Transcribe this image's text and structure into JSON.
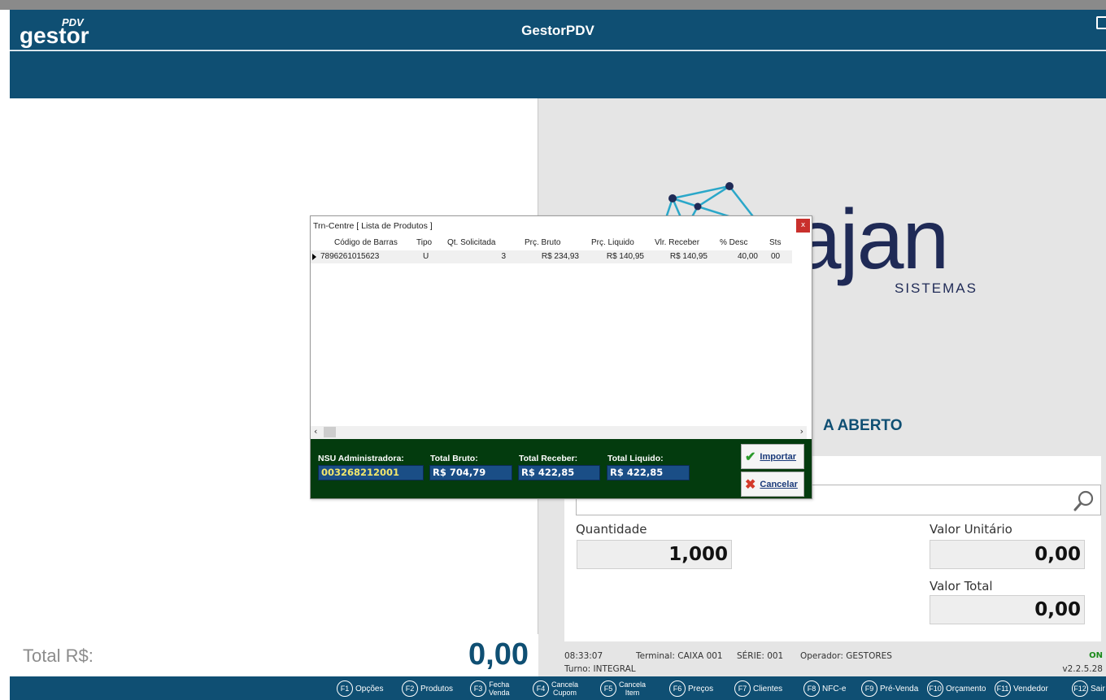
{
  "app": {
    "logo_main": "gestor",
    "logo_sup": "PDV",
    "title": "GestorPDV"
  },
  "brand": {
    "name": "rajan",
    "sub": "SISTEMAS"
  },
  "status": "A ABERTO",
  "fields": {
    "quantidade_label": "Quantidade",
    "quantidade_value": "1,000",
    "valor_unitario_label": "Valor Unitário",
    "valor_unitario_value": "0,00",
    "valor_total_label": "Valor Total",
    "valor_total_value": "0,00"
  },
  "total": {
    "label": "Total R$:",
    "value": "0,00"
  },
  "info": {
    "time": "08:33:07",
    "terminal": "Terminal: CAIXA 001",
    "serie": "SÉRIE: 001",
    "operador": "Operador: GESTORES",
    "turno": "Turno: INTEGRAL",
    "connection": "ON",
    "version": "v2.2.5.28"
  },
  "dialog": {
    "title": "Trn-Centre [ Lista de Produtos ]",
    "close": "x",
    "columns": [
      "Código de Barras",
      "Tipo",
      "Qt. Solicitada",
      "Prç. Bruto",
      "Prç. Liquido",
      "Vlr. Receber",
      "% Desc",
      "Sts"
    ],
    "row": {
      "codigo": "7896261015623",
      "tipo": "U",
      "qt": "3",
      "bruto": "R$ 234,93",
      "liquido": "R$ 140,95",
      "receber": "R$ 140,95",
      "desc": "40,00",
      "sts": "00"
    },
    "nsu_label": "NSU Administradora:",
    "nsu_value": "003268212001",
    "total_bruto_label": "Total Bruto:",
    "total_bruto_value": "R$ 704,79",
    "total_receber_label": "Total Receber:",
    "total_receber_value": "R$ 422,85",
    "total_liquido_label": "Total Liquido:",
    "total_liquido_value": "R$ 422,85",
    "importar_label": "Importar",
    "cancelar_label": "Cancelar"
  },
  "fkeys": [
    {
      "key": "F1",
      "label": "Opções"
    },
    {
      "key": "F2",
      "label": "Produtos"
    },
    {
      "key": "F3",
      "label1": "Fecha",
      "label2": "Venda"
    },
    {
      "key": "F4",
      "label1": "Cancela",
      "label2": "Cupom"
    },
    {
      "key": "F5",
      "label1": "Cancela",
      "label2": "Item"
    },
    {
      "key": "F6",
      "label": "Preços"
    },
    {
      "key": "F7",
      "label": "Clientes"
    },
    {
      "key": "F8",
      "label": "NFC-e"
    },
    {
      "key": "F9",
      "label": "Pré-Venda"
    },
    {
      "key": "F10",
      "label": "Orçamento"
    },
    {
      "key": "F11",
      "label": "Vendedor"
    },
    {
      "key": "F12",
      "label": "Sair"
    }
  ],
  "colors": {
    "primary": "#0f4f73",
    "footer_green": "#033b0e",
    "brand_navy": "#1f2a56",
    "brand_cyan": "#2aa7c9"
  }
}
